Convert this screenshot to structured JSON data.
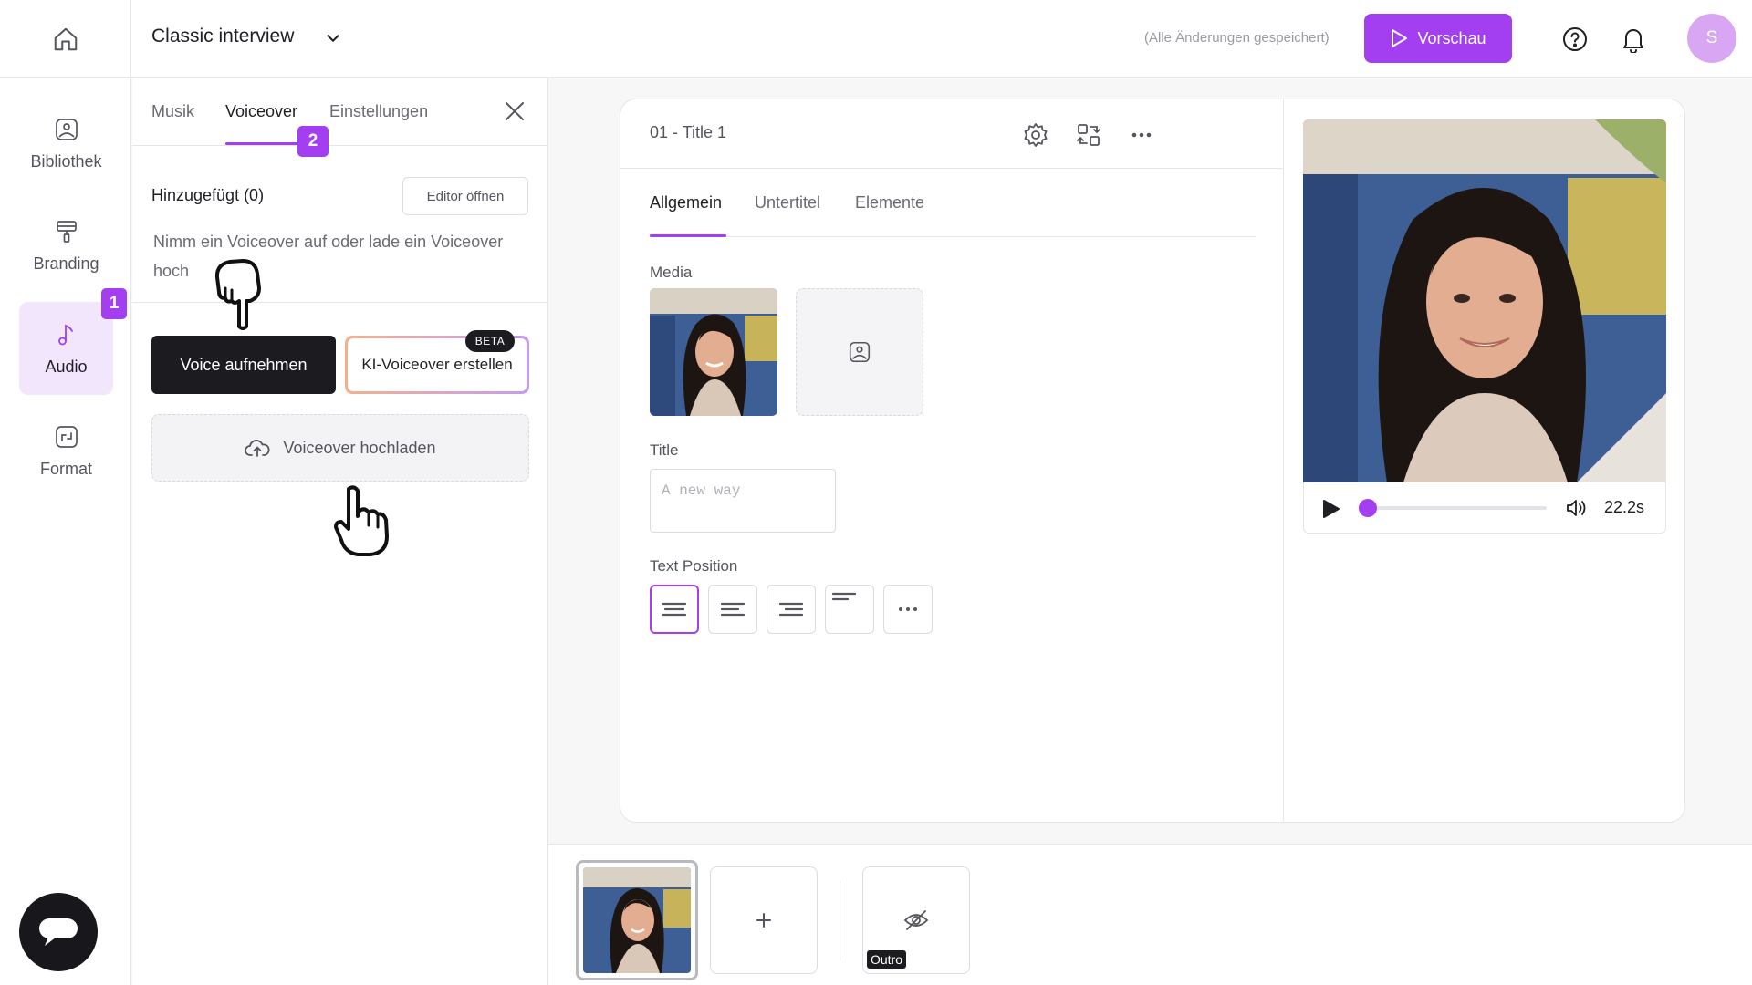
{
  "header": {
    "project_title": "Classic interview",
    "save_status": "(Alle Änderungen gespeichert)",
    "preview_label": "Vorschau",
    "avatar_initial": "S",
    "accent": "#a33ff0"
  },
  "rail": {
    "items": [
      {
        "label": "Bibliothek",
        "icon": "library-image-icon"
      },
      {
        "label": "Branding",
        "icon": "paint-roller-icon"
      },
      {
        "label": "Audio",
        "icon": "music-note-icon",
        "active": true
      },
      {
        "label": "Format",
        "icon": "resize-icon"
      }
    ],
    "step_badge": "1"
  },
  "panel": {
    "tabs": [
      {
        "label": "Musik"
      },
      {
        "label": "Voiceover",
        "active": true
      },
      {
        "label": "Einstellungen"
      }
    ],
    "step_badge": "2",
    "added_label": "Hinzugefügt (0)",
    "editor_button": "Editor öffnen",
    "hint": "Nimm ein Voiceover auf oder lade ein Voiceover hoch",
    "record_button": "Voice aufnehmen",
    "ai_button": "KI-Voiceover erstellen",
    "beta_badge": "BETA",
    "upload_button": "Voiceover hochladen"
  },
  "editor": {
    "slide_title": "01 - Title 1",
    "tabs": [
      {
        "label": "Allgemein",
        "active": true
      },
      {
        "label": "Untertitel"
      },
      {
        "label": "Elemente"
      }
    ],
    "media_label": "Media",
    "title_label": "Title",
    "title_placeholder": "A new way",
    "text_position_label": "Text Position",
    "text_positions": [
      "center",
      "left",
      "right",
      "top-left",
      "more"
    ],
    "selected_position": "center"
  },
  "video": {
    "duration": "22.2s",
    "progress": 0
  },
  "timeline": {
    "outro_label": "Outro"
  }
}
